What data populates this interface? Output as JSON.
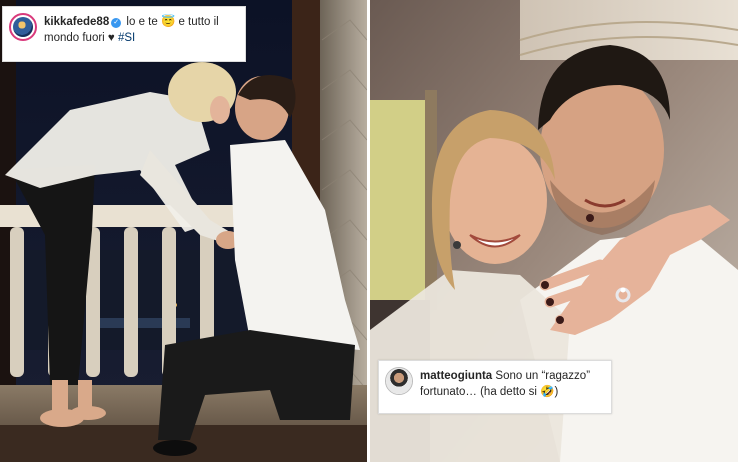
{
  "left_post": {
    "username": "kikkafede88",
    "verified": true,
    "caption": "lo e te 😇 e tutto il mondo fuori ♥",
    "hashtag": "#SI"
  },
  "right_post": {
    "username": "matteogiunta",
    "caption": "Sono un “ragazzo” fortunato… (ha detto si 🤣)"
  },
  "colors": {
    "caption_background": "#ffffff",
    "username_text": "#262626",
    "hashtag_text": "#00376b",
    "verified_badge": "#3897f0",
    "avatar_ring": "#d93a7c"
  },
  "icons": [
    "verified-badge-icon",
    "avatar-photo"
  ]
}
